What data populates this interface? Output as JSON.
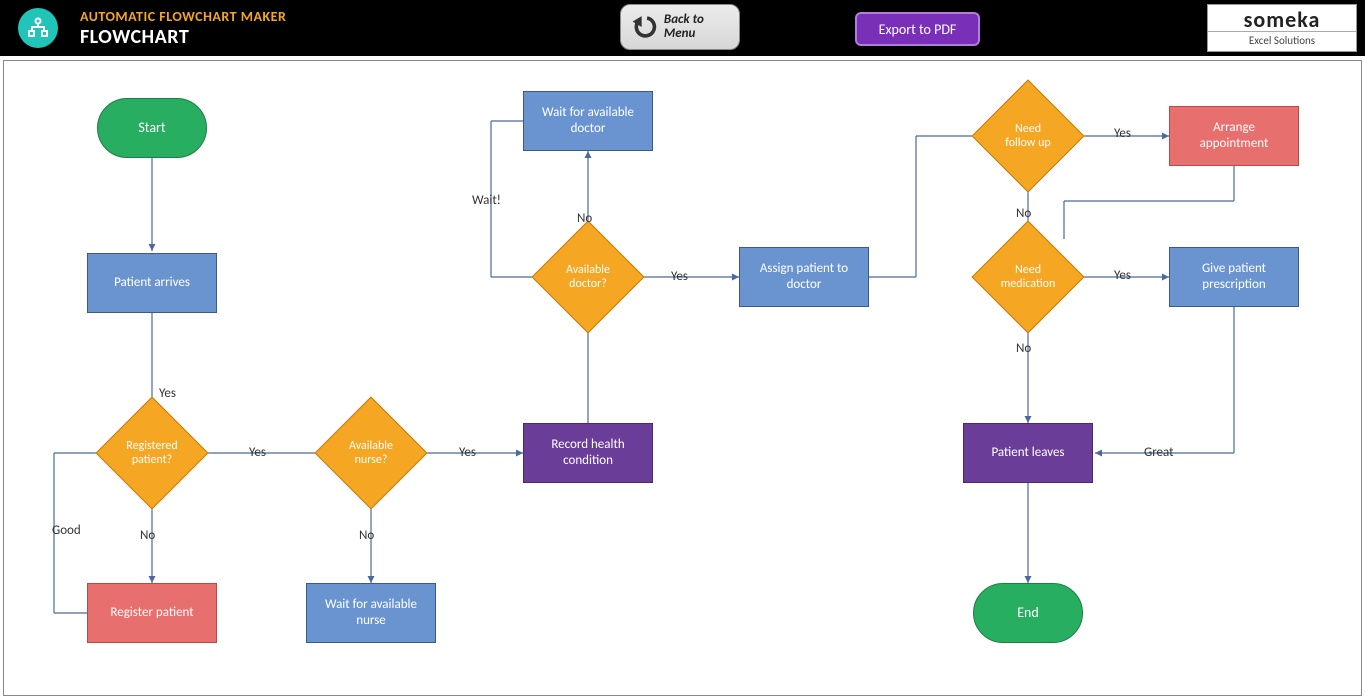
{
  "header": {
    "app_title": "AUTOMATIC FLOWCHART MAKER",
    "page_title": "FLOWCHART",
    "back_label": "Back to Menu",
    "export_label": "Export to PDF",
    "brand_name": "someka",
    "brand_sub": "Excel Solutions"
  },
  "nodes": {
    "start": "Start",
    "patient_arrives": "Patient arrives",
    "registered_patient": "Registered patient?",
    "register_patient": "Register patient",
    "available_nurse": "Available nurse?",
    "wait_nurse": "Wait for available nurse",
    "record_health": "Record health condition",
    "available_doctor": "Available doctor?",
    "wait_doctor": "Wait for available doctor",
    "assign_patient": "Assign patient to doctor",
    "need_follow_up": "Need follow up",
    "arrange_appointment": "Arrange appointment",
    "need_medication": "Need medication",
    "give_prescription": "Give patient prescription",
    "patient_leaves": "Patient leaves",
    "end": "End"
  },
  "labels": {
    "yes": "Yes",
    "no": "No",
    "wait": "Wait!",
    "good": "Good",
    "great": "Great"
  }
}
